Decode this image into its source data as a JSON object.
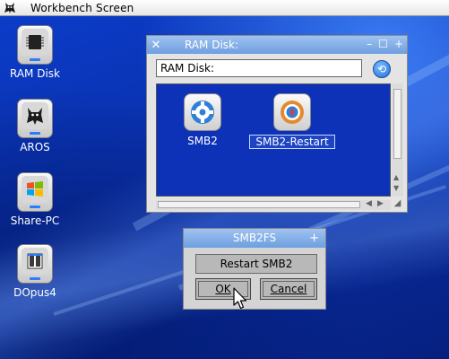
{
  "screen": {
    "title": "Workbench Screen"
  },
  "desktop_icons": [
    {
      "label": "RAM Disk",
      "icon": "ram-chip-icon"
    },
    {
      "label": "AROS",
      "icon": "aros-cat-icon"
    },
    {
      "label": "Share-PC",
      "icon": "windows-flag-icon"
    },
    {
      "label": "DOpus4",
      "icon": "dopus-icon"
    }
  ],
  "ramdisk_window": {
    "title": "RAM Disk:",
    "path": "RAM Disk:",
    "controls": [
      "–",
      "☐",
      "+"
    ],
    "files": [
      {
        "label": "SMB2",
        "icon": "gear-icon",
        "selected": false
      },
      {
        "label": "SMB2-Restart",
        "icon": "compass-gear-icon",
        "selected": true
      }
    ]
  },
  "smb_dialog": {
    "title": "SMB2FS",
    "message": "Restart SMB2",
    "ok_label": "OK",
    "cancel_label": "Cancel"
  },
  "colors": {
    "desktop": "#0a2fa8",
    "window_title": "#7fa9e6",
    "drawer_bg": "#0d32b8"
  }
}
